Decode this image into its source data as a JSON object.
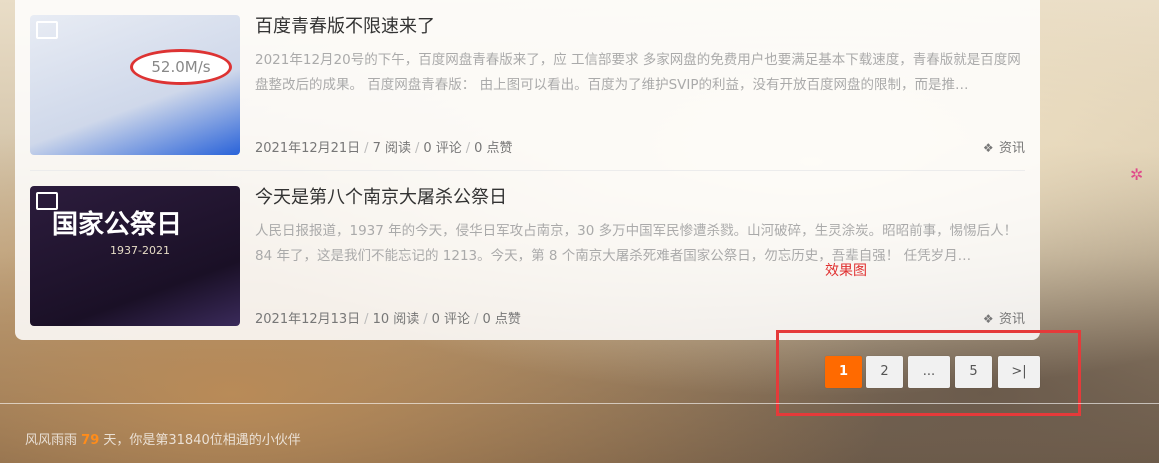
{
  "posts": [
    {
      "title": "百度青春版不限速来了",
      "excerpt": "2021年12月20号的下午，百度网盘青春版来了，应 工信部要求 多家网盘的免费用户也要满足基本下载速度，青春版就是百度网盘整改后的成果。 百度网盘青春版： 由上图可以看出。百度为了维护SVIP的利益，没有开放百度网盘的限制，而是推…",
      "date": "2021年12月21日",
      "reads": "7 阅读",
      "comments": "0 评论",
      "likes": "0 点赞",
      "category": "资讯",
      "thumb_text": "52.0M/s"
    },
    {
      "title": "今天是第八个南京大屠杀公祭日",
      "excerpt": "人民日报报道，1937 年的今天，侵华日军攻占南京，30 多万中国军民惨遭杀戮。山河破碎，生灵涂炭。昭昭前事，惕惕后人！84 年了，这是我们不能忘记的 1213。今天，第 8 个南京大屠杀死难者国家公祭日，勿忘历史，吾辈自强！ 任凭岁月…",
      "date": "2021年12月13日",
      "reads": "10 阅读",
      "comments": "0 评论",
      "likes": "0 点赞",
      "category": "资讯",
      "thumb_text": "国家公祭日",
      "thumb_sub": "1937-2021"
    }
  ],
  "annotation": "效果图",
  "pagination": [
    "1",
    "2",
    "...",
    "5",
    ">|"
  ],
  "footer": {
    "prefix": "风风雨雨",
    "days": "79",
    "suffix": "天，你是第31840位相遇的小伙伴"
  },
  "colors": {
    "accent": "#ff6a00",
    "highlight_box": "#e53a3a"
  }
}
